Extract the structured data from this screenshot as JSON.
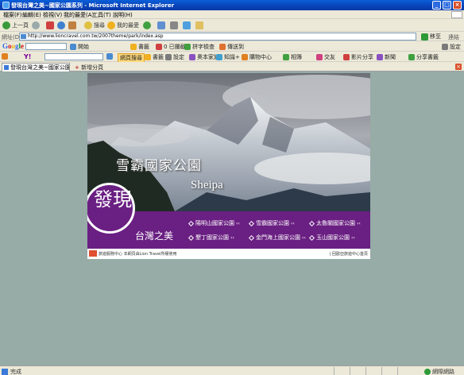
{
  "window": {
    "title": "發現台灣之美~國家公園系列 - Microsoft Internet Explorer"
  },
  "menu": [
    "檔案(F)",
    "編輯(E)",
    "檢視(V)",
    "我的最愛(A)",
    "工具(T)",
    "說明(H)"
  ],
  "toolbar": {
    "back": "上一頁",
    "search": "搜尋",
    "favorites": "我的最愛"
  },
  "address": {
    "label": "網址(D)",
    "url": "http://www.lioncravel.com.tw/2007theme/park/index.asp",
    "go": "移至",
    "links": "連結"
  },
  "google": {
    "logo": "Google",
    "go": "開始",
    "bookmarks": "書籤",
    "blocked": "0 已攔截",
    "check": "拼字檢查",
    "send": "傳送到",
    "settings": "設定"
  },
  "yahoo": {
    "logo": "Y!",
    "search": "網頁搜尋",
    "bookmarks": "書籤",
    "settings": "設定",
    "mail": "奇摩信箱",
    "my": "我的最愛",
    "shop": "購物中心",
    "links": [
      "奧本家族",
      "知識+",
      "相簿",
      "影片分享",
      "交友",
      "新聞",
      "分享書籤"
    ]
  },
  "tab": {
    "label": "發現台灣之美~國家公園系列",
    "new": "新增分頁"
  },
  "page": {
    "title_zh": "雪霸國家公園",
    "title_en": "Sheipa",
    "badge": "發現",
    "badge_sub": "台灣之美",
    "parks": [
      "陽明山國家公園",
      "雪霸國家公園",
      "太魯閣國家公園",
      "墾丁國家公園",
      "金門海上國家公園",
      "玉山國家公園"
    ],
    "footer_left": "旅遊服務中心 本網頁由Lion Travel所權使用",
    "footer_right": "| 回歐亞旅遊中心首頁"
  },
  "status": {
    "left": "完成",
    "zone": "網際網路"
  },
  "colors": {
    "purple": "#6a1f82",
    "background": "#97aba7"
  }
}
